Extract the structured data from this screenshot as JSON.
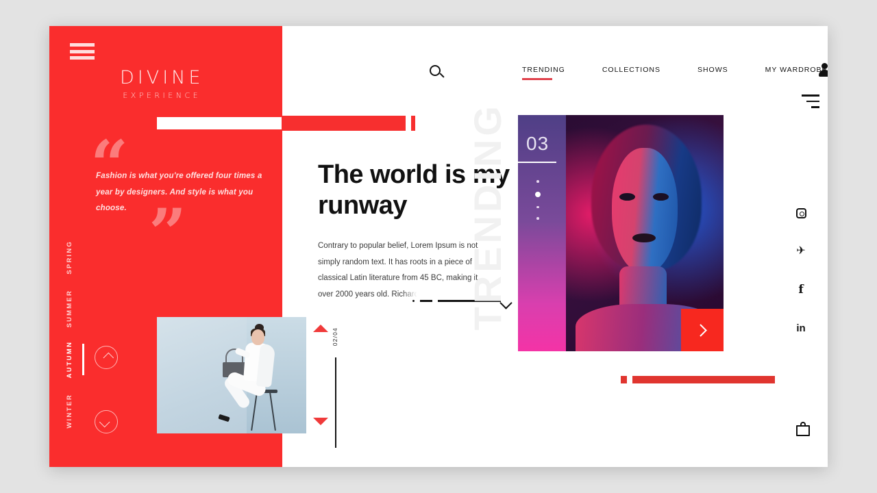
{
  "brand": {
    "logo_main": "DIVINE",
    "logo_sub": "EXPERIENCE",
    "menu_icon": "hamburger-icon"
  },
  "nav": {
    "search_icon": "search-icon",
    "account_icon": "user-avatar-icon",
    "secondary_menu_icon": "menu-stack-icon",
    "items": [
      {
        "label": "TRENDING",
        "active": true
      },
      {
        "label": "COLLECTIONS",
        "active": false
      },
      {
        "label": "SHOWS",
        "active": false
      },
      {
        "label": "MY WARDROBE",
        "active": false
      }
    ]
  },
  "quote": {
    "text": "Fashion is what you're offered four times a year by designers. And style is what you choose.",
    "open_mark": "“",
    "close_mark": "”"
  },
  "seasons": [
    {
      "label": "SPRING",
      "active": false
    },
    {
      "label": "SUMMER",
      "active": false
    },
    {
      "label": "AUTUMN",
      "active": true
    },
    {
      "label": "WINTER",
      "active": false
    }
  ],
  "season_nav": {
    "up_icon": "chevron-up-icon",
    "down_icon": "chevron-down-icon"
  },
  "hero": {
    "headline": "The world is my runway",
    "body": "Contrary to popular belief, Lorem Ipsum is not simply random text. It has roots in a piece of classical Latin literature from 45 BC, making it over 2000 years old. ",
    "body_fade": "Richard",
    "scroll_icon": "chevron-down-icon"
  },
  "product_slider": {
    "up_icon": "triangle-up-icon",
    "down_icon": "triangle-down-icon",
    "counter": "02/04",
    "image_alt": "woman-in-white-with-handbag"
  },
  "trending": {
    "watermark": "TRENDING",
    "slide_number": "03",
    "dots": [
      {
        "active": false
      },
      {
        "active": true
      },
      {
        "active": false
      },
      {
        "active": false
      }
    ],
    "next_icon": "chevron-right-icon",
    "image_alt": "neon-lit-portrait"
  },
  "social": [
    {
      "name": "instagram",
      "glyph": ""
    },
    {
      "name": "twitter",
      "glyph": "✈"
    },
    {
      "name": "facebook",
      "glyph": "f"
    },
    {
      "name": "linkedin",
      "glyph": "in"
    }
  ],
  "cart": {
    "icon": "shopping-bag-icon"
  },
  "colors": {
    "brand_red": "#fa2d2d",
    "accent_red": "#f7281f",
    "nav_underline": "#e0404a",
    "canvas": "#ffffff",
    "page_bg": "#e3e3e3",
    "watermark": "#f1f1f1"
  }
}
